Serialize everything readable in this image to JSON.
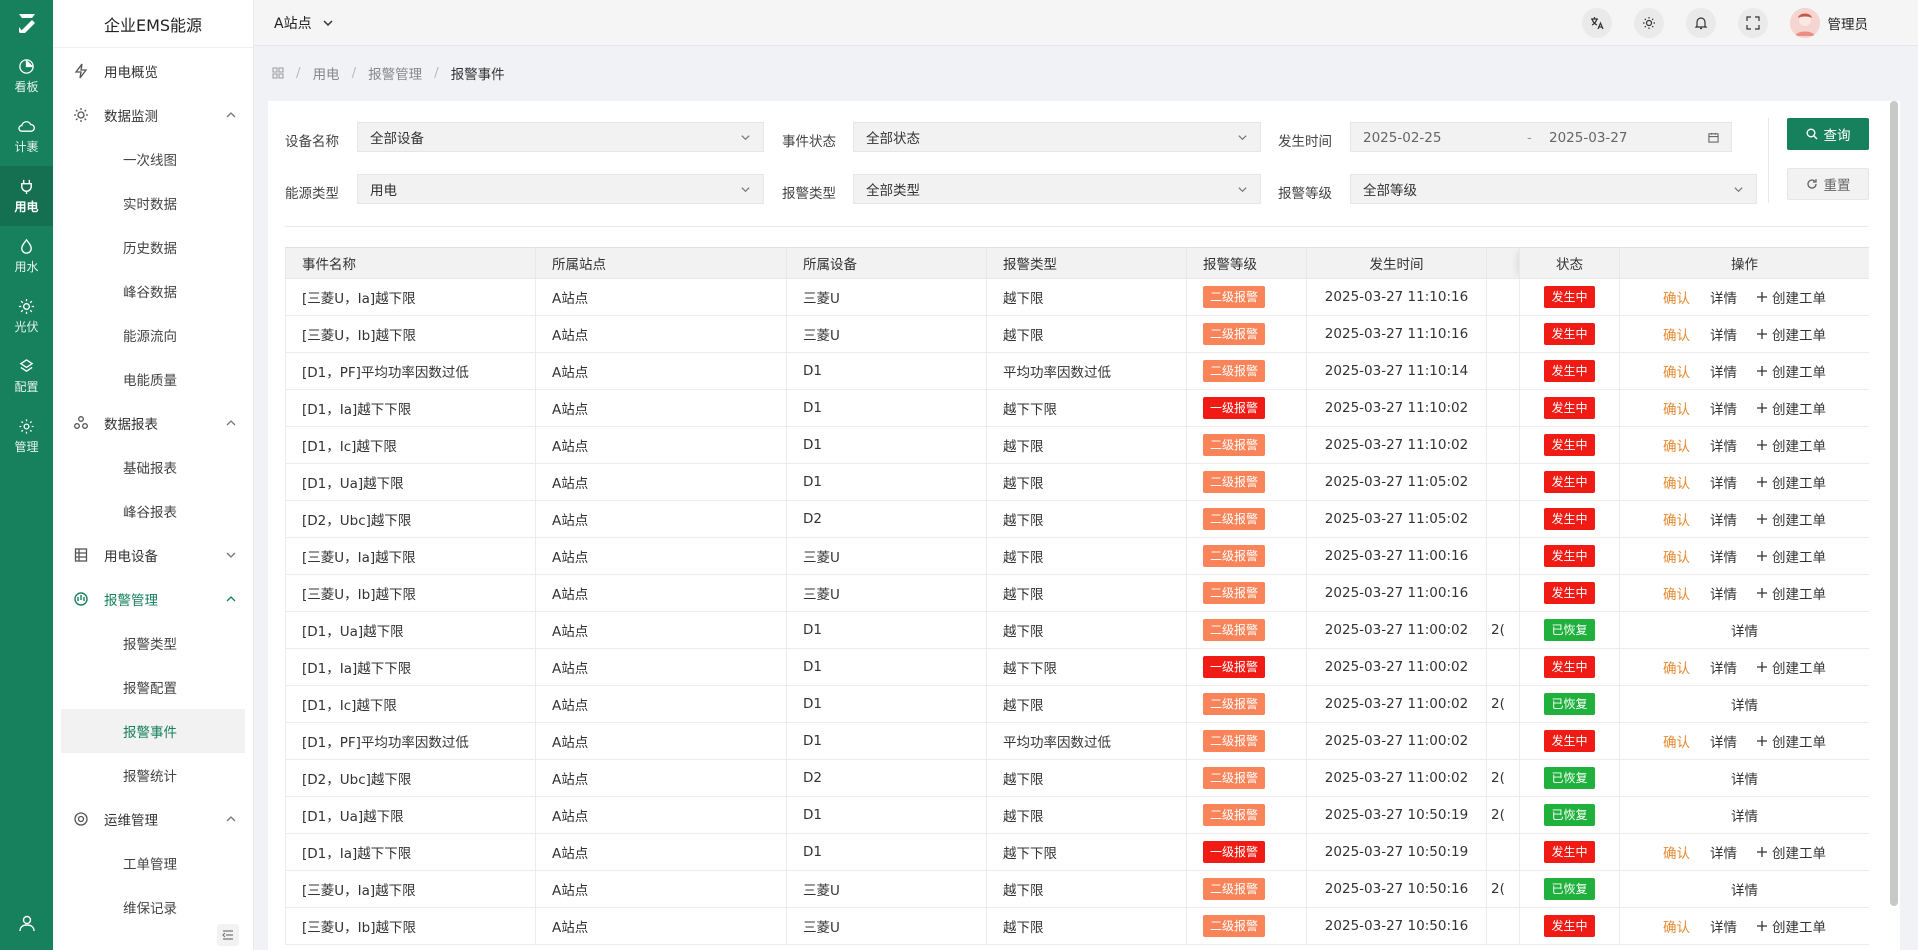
{
  "app": {
    "title": "企业EMS能源"
  },
  "rail": [
    {
      "id": "board",
      "label": "看板",
      "icon": "pie-chart-icon"
    },
    {
      "id": "metering",
      "label": "计裹",
      "icon": "cloud-icon"
    },
    {
      "id": "power",
      "label": "用电",
      "icon": "plug-icon",
      "active": true
    },
    {
      "id": "water",
      "label": "用水",
      "icon": "water-drop-icon"
    },
    {
      "id": "pv",
      "label": "光伏",
      "icon": "sun-icon"
    },
    {
      "id": "config",
      "label": "配置",
      "icon": "config-icon"
    },
    {
      "id": "manage",
      "label": "管理",
      "icon": "gear-icon"
    }
  ],
  "menu": {
    "overview": "用电概览",
    "monitoring": {
      "label": "数据监测",
      "items": [
        "一次线图",
        "实时数据",
        "历史数据",
        "峰谷数据",
        "能源流向",
        "电能质量"
      ]
    },
    "reports": {
      "label": "数据报表",
      "items": [
        "基础报表",
        "峰谷报表"
      ]
    },
    "devices": "用电设备",
    "alarm": {
      "label": "报警管理",
      "items": [
        "报警类型",
        "报警配置",
        "报警事件",
        "报警统计"
      ]
    },
    "ops": {
      "label": "运维管理",
      "items": [
        "工单管理",
        "维保记录"
      ]
    }
  },
  "topbar": {
    "site": "A站点",
    "user": "管理员"
  },
  "breadcrumb": [
    "用电",
    "报警管理",
    "报警事件"
  ],
  "filters": {
    "device_label": "设备名称",
    "device_value": "全部设备",
    "status_label": "事件状态",
    "status_value": "全部状态",
    "time_label": "发生时间",
    "time_start": "2025-02-25",
    "time_sep": "-",
    "time_end": "2025-03-27",
    "energy_label": "能源类型",
    "energy_value": "用电",
    "alarm_type_label": "报警类型",
    "alarm_type_value": "全部类型",
    "alarm_level_label": "报警等级",
    "alarm_level_value": "全部等级",
    "query": "查询",
    "reset": "重置"
  },
  "table": {
    "headers": {
      "name": "事件名称",
      "site": "所属站点",
      "device": "所属设备",
      "type": "报警类型",
      "level": "报警等级",
      "time": "发生时间",
      "status": "状态",
      "ops": "操作"
    },
    "ops": {
      "confirm": "确认",
      "detail": "详情",
      "create": "创建工单"
    },
    "rows": [
      {
        "name": "[三菱U，Ia]越下限",
        "site": "A站点",
        "device": "三菱U",
        "type": "越下限",
        "level": "二级报警",
        "time": "2025-03-27 11:10:16",
        "end": "",
        "status": "发生中"
      },
      {
        "name": "[三菱U，Ib]越下限",
        "site": "A站点",
        "device": "三菱U",
        "type": "越下限",
        "level": "二级报警",
        "time": "2025-03-27 11:10:16",
        "end": "",
        "status": "发生中"
      },
      {
        "name": "[D1，PF]平均功率因数过低",
        "site": "A站点",
        "device": "D1",
        "type": "平均功率因数过低",
        "level": "二级报警",
        "time": "2025-03-27 11:10:14",
        "end": "",
        "status": "发生中"
      },
      {
        "name": "[D1，Ia]越下下限",
        "site": "A站点",
        "device": "D1",
        "type": "越下下限",
        "level": "一级报警",
        "time": "2025-03-27 11:10:02",
        "end": "",
        "status": "发生中"
      },
      {
        "name": "[D1，Ic]越下限",
        "site": "A站点",
        "device": "D1",
        "type": "越下限",
        "level": "二级报警",
        "time": "2025-03-27 11:10:02",
        "end": "",
        "status": "发生中"
      },
      {
        "name": "[D1，Ua]越下限",
        "site": "A站点",
        "device": "D1",
        "type": "越下限",
        "level": "二级报警",
        "time": "2025-03-27 11:05:02",
        "end": "",
        "status": "发生中"
      },
      {
        "name": "[D2，Ubc]越下限",
        "site": "A站点",
        "device": "D2",
        "type": "越下限",
        "level": "二级报警",
        "time": "2025-03-27 11:05:02",
        "end": "",
        "status": "发生中"
      },
      {
        "name": "[三菱U，Ia]越下限",
        "site": "A站点",
        "device": "三菱U",
        "type": "越下限",
        "level": "二级报警",
        "time": "2025-03-27 11:00:16",
        "end": "",
        "status": "发生中"
      },
      {
        "name": "[三菱U，Ib]越下限",
        "site": "A站点",
        "device": "三菱U",
        "type": "越下限",
        "level": "二级报警",
        "time": "2025-03-27 11:00:16",
        "end": "",
        "status": "发生中"
      },
      {
        "name": "[D1，Ua]越下限",
        "site": "A站点",
        "device": "D1",
        "type": "越下限",
        "level": "二级报警",
        "time": "2025-03-27 11:00:02",
        "end": "2(",
        "status": "已恢复"
      },
      {
        "name": "[D1，Ia]越下下限",
        "site": "A站点",
        "device": "D1",
        "type": "越下下限",
        "level": "一级报警",
        "time": "2025-03-27 11:00:02",
        "end": "",
        "status": "发生中"
      },
      {
        "name": "[D1，Ic]越下限",
        "site": "A站点",
        "device": "D1",
        "type": "越下限",
        "level": "二级报警",
        "time": "2025-03-27 11:00:02",
        "end": "2(",
        "status": "已恢复"
      },
      {
        "name": "[D1，PF]平均功率因数过低",
        "site": "A站点",
        "device": "D1",
        "type": "平均功率因数过低",
        "level": "二级报警",
        "time": "2025-03-27 11:00:02",
        "end": "",
        "status": "发生中"
      },
      {
        "name": "[D2，Ubc]越下限",
        "site": "A站点",
        "device": "D2",
        "type": "越下限",
        "level": "二级报警",
        "time": "2025-03-27 11:00:02",
        "end": "2(",
        "status": "已恢复"
      },
      {
        "name": "[D1，Ua]越下限",
        "site": "A站点",
        "device": "D1",
        "type": "越下限",
        "level": "二级报警",
        "time": "2025-03-27 10:50:19",
        "end": "2(",
        "status": "已恢复"
      },
      {
        "name": "[D1，Ia]越下下限",
        "site": "A站点",
        "device": "D1",
        "type": "越下下限",
        "level": "一级报警",
        "time": "2025-03-27 10:50:19",
        "end": "",
        "status": "发生中"
      },
      {
        "name": "[三菱U，Ia]越下限",
        "site": "A站点",
        "device": "三菱U",
        "type": "越下限",
        "level": "二级报警",
        "time": "2025-03-27 10:50:16",
        "end": "2(",
        "status": "已恢复"
      },
      {
        "name": "[三菱U，Ib]越下限",
        "site": "A站点",
        "device": "三菱U",
        "type": "越下限",
        "level": "二级报警",
        "time": "2025-03-27 10:50:16",
        "end": "",
        "status": "发生中"
      }
    ]
  },
  "colors": {
    "brand": "#17805d",
    "level2": "#f9845a",
    "level1": "#ef1b14",
    "ongoing": "#ef1b14",
    "recovered": "#1fb13c",
    "confirm": "#e6892f"
  }
}
